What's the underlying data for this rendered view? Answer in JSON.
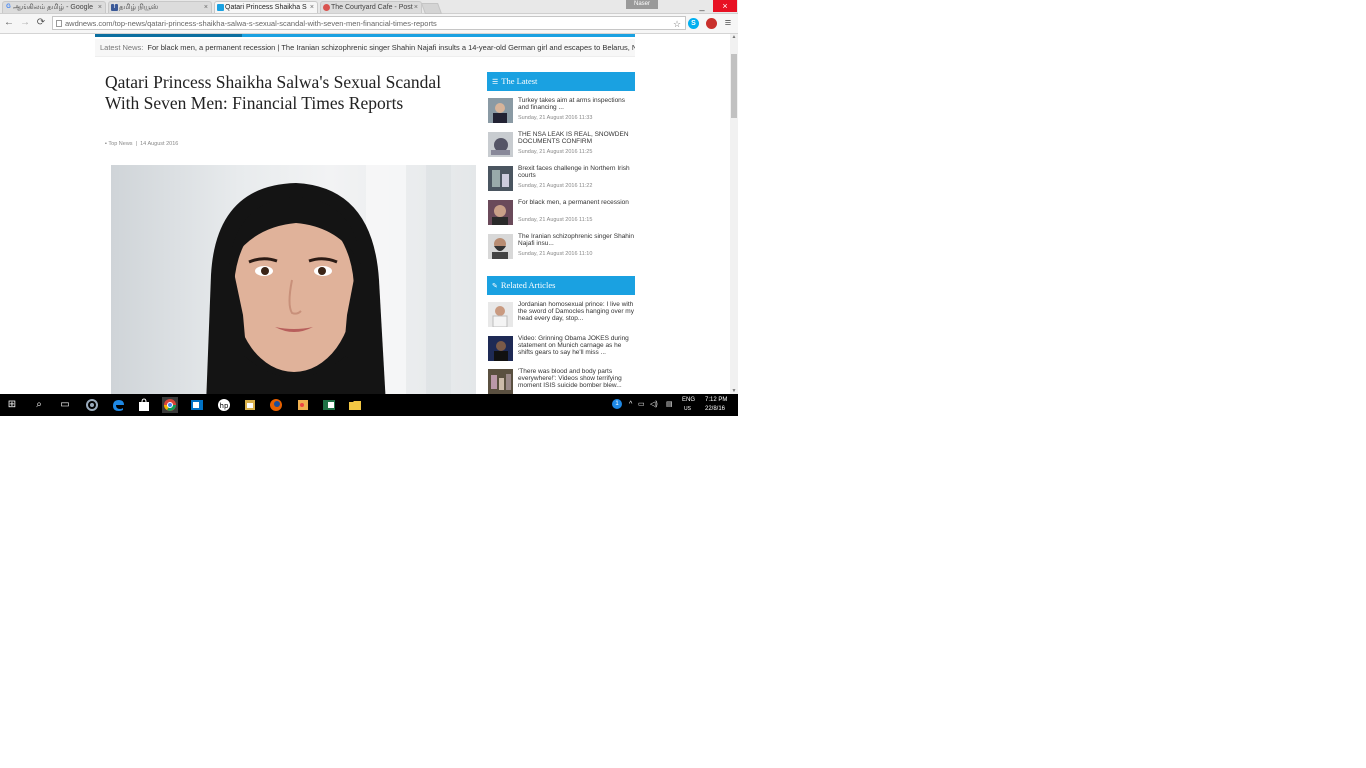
{
  "browser": {
    "tabs": [
      {
        "label": "ஆங்கிலம் தமிழ் - Google",
        "favicon": "google-icon"
      },
      {
        "label": "தமிழ் நியூஸ்",
        "favicon": "facebook-icon"
      },
      {
        "label": "Qatari Princess Shaikha S",
        "favicon": "site-icon",
        "active": true
      },
      {
        "label": "The Courtyard Cafe - Post",
        "favicon": "site-icon"
      }
    ],
    "tab_close": "×",
    "user_label": "Naser",
    "window_controls": {
      "minimize": "_",
      "close": "×"
    },
    "url": "awdnews.com/top-news/qatari-princess-shaikha-salwa-s-sexual-scandal-with-seven-men-financial-times-reports",
    "nav": {
      "back": "←",
      "forward": "→",
      "reload": "⟳"
    },
    "toolbar_icons": {
      "star": "☆",
      "skype": "S",
      "ext": "●",
      "menu": "≡"
    }
  },
  "page": {
    "ticker_label": "Latest News:",
    "ticker_text": "For black men, a permanent recession | The Iranian schizophrenic singer Shahin Najafi insults a 14-year-old German girl and escapes to Belarus, Nigeria Media",
    "headline": "Qatari Princess Shaikha Salwa's Sexual Scandal With Seven Men: Financial Times Reports",
    "meta_category": "Top News",
    "meta_date": "14 August 2016",
    "sidebar": {
      "latest_heading": "The Latest",
      "latest_items": [
        {
          "title": "Turkey takes aim at arms inspections and financing ...",
          "date": "Sunday, 21 August 2016 11:33"
        },
        {
          "title": "THE NSA LEAK IS REAL, SNOWDEN DOCUMENTS CONFIRM",
          "date": "Sunday, 21 August 2016 11:25"
        },
        {
          "title": "Brexit faces challenge in Northern Irish courts",
          "date": "Sunday, 21 August 2016 11:22"
        },
        {
          "title": "For black men, a permanent recession",
          "date": "Sunday, 21 August 2016 11:15"
        },
        {
          "title": "The Iranian schizophrenic singer Shahin Najafi insu...",
          "date": "Sunday, 21 August 2016 11:10"
        }
      ],
      "related_heading": "Related Articles",
      "related_items": [
        {
          "title": "Jordanian homosexual prince: I live with the sword of Damocles hanging over my head every day, stop..."
        },
        {
          "title": "Video: Grinning Obama JOKES during statement on Munich carnage as he shifts gears to say he'll miss ..."
        },
        {
          "title": "'There was blood and body parts everywhere!': Videos show terrifying moment ISIS suicide bomber blew..."
        }
      ]
    }
  },
  "taskbar": {
    "start": "⊞",
    "search": "⌕",
    "task_view": "▭",
    "apps": [
      "settings",
      "edge",
      "store",
      "chrome",
      "outlook",
      "hp",
      "explorer2",
      "firefox",
      "paint",
      "excel",
      "folder"
    ],
    "tray": {
      "lang": "ENG",
      "region": "US",
      "time": "7:12 PM",
      "date": "22/8/16",
      "notif_badge": "1"
    }
  },
  "colors": {
    "accent": "#1aa1e1",
    "close": "#e81123"
  }
}
